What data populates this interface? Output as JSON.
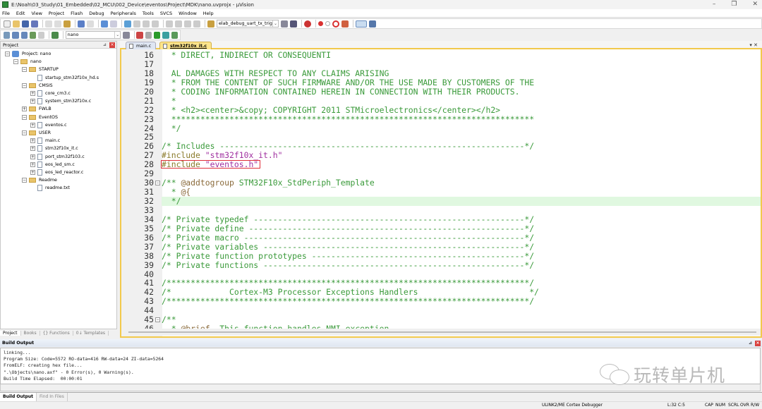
{
  "window": {
    "title": "E:\\Noah\\03_Study\\01_Embedded\\02_MCU\\002_Device\\eventos\\Project\\MDK\\nano.uvprojx - µVision",
    "minimize": "–",
    "maximize": "❐",
    "close": "✕"
  },
  "menu": [
    "File",
    "Edit",
    "View",
    "Project",
    "Flash",
    "Debug",
    "Peripherals",
    "Tools",
    "SVCS",
    "Window",
    "Help"
  ],
  "toolbar": {
    "find_combo": "elab_debug_uart_tx_trig",
    "target_combo": "nano"
  },
  "colors": {
    "accent_border": "#f2c94c",
    "active_tab": "#fde58b",
    "comment": "#3a9a3a",
    "preprocessor": "#8a7a2a",
    "string": "#a030a0",
    "current_line": "#e0f8e0",
    "highlight_box": "#e0303a"
  },
  "project_panel": {
    "title": "Project",
    "tree": [
      {
        "label": "Project: nano",
        "depth": 0,
        "icon": "project",
        "exp": "−"
      },
      {
        "label": "nano",
        "depth": 1,
        "icon": "folder",
        "exp": "−"
      },
      {
        "label": "STARTUP",
        "depth": 2,
        "icon": "folder",
        "exp": "−"
      },
      {
        "label": "startup_stm32f10x_hd.s",
        "depth": 3,
        "icon": "file",
        "exp": ""
      },
      {
        "label": "CMSIS",
        "depth": 2,
        "icon": "folder",
        "exp": "−"
      },
      {
        "label": "core_cm3.c",
        "depth": 3,
        "icon": "file",
        "exp": "+"
      },
      {
        "label": "system_stm32f10x.c",
        "depth": 3,
        "icon": "file",
        "exp": "+"
      },
      {
        "label": "FWLB",
        "depth": 2,
        "icon": "folder",
        "exp": "+"
      },
      {
        "label": "EventOS",
        "depth": 2,
        "icon": "folder",
        "exp": "−"
      },
      {
        "label": "eventos.c",
        "depth": 3,
        "icon": "file",
        "exp": "+"
      },
      {
        "label": "USER",
        "depth": 2,
        "icon": "folder",
        "exp": "−"
      },
      {
        "label": "main.c",
        "depth": 3,
        "icon": "file",
        "exp": "+"
      },
      {
        "label": "stm32f10x_it.c",
        "depth": 3,
        "icon": "file",
        "exp": "+"
      },
      {
        "label": "port_stm32f103.c",
        "depth": 3,
        "icon": "file",
        "exp": "+"
      },
      {
        "label": "eos_led_sm.c",
        "depth": 3,
        "icon": "file",
        "exp": "+"
      },
      {
        "label": "eos_led_reactor.c",
        "depth": 3,
        "icon": "file",
        "exp": "+"
      },
      {
        "label": "Readme",
        "depth": 2,
        "icon": "folder",
        "exp": "−"
      },
      {
        "label": "readme.txt",
        "depth": 3,
        "icon": "file",
        "exp": ""
      }
    ],
    "tabs": [
      "Project",
      "Books",
      "{} Functions",
      "0↓ Templates"
    ]
  },
  "editor": {
    "tabs": [
      {
        "label": "main.c",
        "active": false
      },
      {
        "label": "stm32f10x_it.c",
        "active": true
      }
    ],
    "tab_controls": "▾ ✕",
    "highlighted_line": 32,
    "boxed_line": 28,
    "lines": [
      {
        "n": "16",
        "parts": [
          {
            "t": "  * DIRECT, INDIRECT OR CONSEQUENTI",
            "c": "cmt"
          }
        ]
      },
      {
        "n": "17",
        "parts": []
      },
      {
        "n": "18",
        "parts": [
          {
            "t": "  AL DAMAGES WITH RESPECT TO ANY CLAIMS ARISING",
            "c": "cmt"
          }
        ]
      },
      {
        "n": "19",
        "parts": [
          {
            "t": "  * FROM THE CONTENT OF SUCH FIRMWARE AND/OR THE USE MADE BY CUSTOMERS OF THE",
            "c": "cmt"
          }
        ]
      },
      {
        "n": "20",
        "parts": [
          {
            "t": "  * CODING INFORMATION CONTAINED HEREIN IN CONNECTION WITH THEIR PRODUCTS.",
            "c": "cmt"
          }
        ]
      },
      {
        "n": "21",
        "parts": [
          {
            "t": "  *",
            "c": "cmt"
          }
        ]
      },
      {
        "n": "22",
        "parts": [
          {
            "t": "  * <h2><center>&copy; COPYRIGHT 2011 STMicroelectronics</center></h2>",
            "c": "cmt"
          }
        ]
      },
      {
        "n": "23",
        "parts": [
          {
            "t": "  ***************************************************************************",
            "c": "cmt"
          }
        ]
      },
      {
        "n": "24",
        "parts": [
          {
            "t": "  */",
            "c": "cmt"
          }
        ]
      },
      {
        "n": "25",
        "parts": []
      },
      {
        "n": "26",
        "parts": [
          {
            "t": "/* Includes ---------------------------------------------------------------*/",
            "c": "cmt"
          }
        ]
      },
      {
        "n": "27",
        "parts": [
          {
            "t": "#include ",
            "c": "pp"
          },
          {
            "t": "\"stm32f10x_it.h\"",
            "c": "str"
          }
        ]
      },
      {
        "n": "28",
        "parts": [
          {
            "t": "#include ",
            "c": "pp"
          },
          {
            "t": "\"eventos.h\"",
            "c": "str"
          }
        ]
      },
      {
        "n": "29",
        "parts": []
      },
      {
        "n": "30",
        "fold": "−",
        "parts": [
          {
            "t": "/** ",
            "c": "cmt"
          },
          {
            "t": "@addtogroup",
            "c": "doc"
          },
          {
            "t": " STM32F10x_StdPeriph_Template",
            "c": "cmt"
          }
        ]
      },
      {
        "n": "31",
        "parts": [
          {
            "t": "  * ",
            "c": "cmt"
          },
          {
            "t": "@{",
            "c": "doc"
          }
        ]
      },
      {
        "n": "32",
        "parts": [
          {
            "t": "  */",
            "c": "cmt"
          }
        ]
      },
      {
        "n": "33",
        "parts": []
      },
      {
        "n": "34",
        "parts": [
          {
            "t": "/* Private typedef --------------------------------------------------------*/",
            "c": "cmt"
          }
        ]
      },
      {
        "n": "35",
        "parts": [
          {
            "t": "/* Private define ---------------------------------------------------------*/",
            "c": "cmt"
          }
        ]
      },
      {
        "n": "36",
        "parts": [
          {
            "t": "/* Private macro ----------------------------------------------------------*/",
            "c": "cmt"
          }
        ]
      },
      {
        "n": "37",
        "parts": [
          {
            "t": "/* Private variables ------------------------------------------------------*/",
            "c": "cmt"
          }
        ]
      },
      {
        "n": "38",
        "parts": [
          {
            "t": "/* Private function prototypes --------------------------------------------*/",
            "c": "cmt"
          }
        ]
      },
      {
        "n": "39",
        "parts": [
          {
            "t": "/* Private functions ------------------------------------------------------*/",
            "c": "cmt"
          }
        ]
      },
      {
        "n": "40",
        "parts": []
      },
      {
        "n": "41",
        "parts": [
          {
            "t": "/***************************************************************************/",
            "c": "cmt"
          }
        ]
      },
      {
        "n": "42",
        "parts": [
          {
            "t": "/*            Cortex-M3 Processor Exceptions Handlers                       */",
            "c": "cmt"
          }
        ]
      },
      {
        "n": "43",
        "parts": [
          {
            "t": "/***************************************************************************/",
            "c": "cmt"
          }
        ]
      },
      {
        "n": "44",
        "parts": []
      },
      {
        "n": "45",
        "fold": "−",
        "parts": [
          {
            "t": "/**",
            "c": "cmt"
          }
        ]
      },
      {
        "n": "46",
        "parts": [
          {
            "t": "  * ",
            "c": "cmt"
          },
          {
            "t": "@brief",
            "c": "doc"
          },
          {
            "t": "  This function handles NMI exception.",
            "c": "cmt"
          }
        ]
      }
    ]
  },
  "build_output": {
    "title": "Build Output",
    "text": "linking...\nProgram Size: Code=5572 RO-data=416 RW-data=24 ZI-data=5264\nFromELF: creating hex file...\n\".\\Objects\\nano.axf\" - 0 Error(s), 0 Warning(s).\nBuild Time Elapsed:  00:00:01",
    "tabs": [
      "Build Output",
      "Find In Files"
    ],
    "watermark": "玩转单片机"
  },
  "status": {
    "debugger": "ULINK2/ME Cortex Debugger",
    "position": "L:32 C:5",
    "indicators": [
      "CAP",
      "NUM",
      "SCRL",
      "OVR",
      "R/W"
    ]
  }
}
